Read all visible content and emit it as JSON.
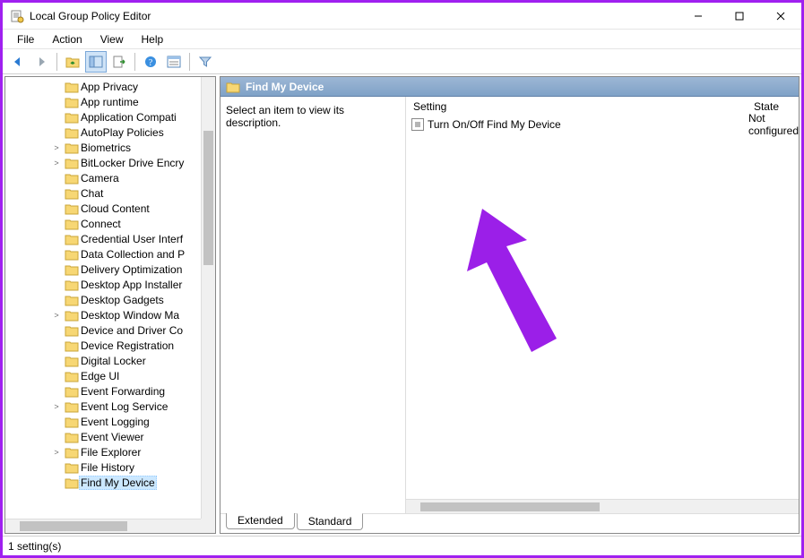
{
  "titlebar": {
    "title": "Local Group Policy Editor"
  },
  "menubar": {
    "items": [
      "File",
      "Action",
      "View",
      "Help"
    ]
  },
  "toolbar": {
    "icons": [
      "back-arrow-icon",
      "forward-arrow-icon",
      "sep",
      "up-folder-icon",
      "show-hide-tree-icon",
      "export-list-icon",
      "sep",
      "help-icon",
      "properties-icon",
      "sep",
      "filter-icon"
    ]
  },
  "tree": {
    "items": [
      {
        "label": "App Privacy",
        "expander": ""
      },
      {
        "label": "App runtime",
        "expander": ""
      },
      {
        "label": "Application Compati",
        "expander": ""
      },
      {
        "label": "AutoPlay Policies",
        "expander": ""
      },
      {
        "label": "Biometrics",
        "expander": ">"
      },
      {
        "label": "BitLocker Drive Encry",
        "expander": ">"
      },
      {
        "label": "Camera",
        "expander": ""
      },
      {
        "label": "Chat",
        "expander": ""
      },
      {
        "label": "Cloud Content",
        "expander": ""
      },
      {
        "label": "Connect",
        "expander": ""
      },
      {
        "label": "Credential User Interf",
        "expander": ""
      },
      {
        "label": "Data Collection and P",
        "expander": ""
      },
      {
        "label": "Delivery Optimization",
        "expander": ""
      },
      {
        "label": "Desktop App Installer",
        "expander": ""
      },
      {
        "label": "Desktop Gadgets",
        "expander": ""
      },
      {
        "label": "Desktop Window Ma",
        "expander": ">"
      },
      {
        "label": "Device and Driver Co",
        "expander": ""
      },
      {
        "label": "Device Registration",
        "expander": ""
      },
      {
        "label": "Digital Locker",
        "expander": ""
      },
      {
        "label": "Edge UI",
        "expander": ""
      },
      {
        "label": "Event Forwarding",
        "expander": ""
      },
      {
        "label": "Event Log Service",
        "expander": ">"
      },
      {
        "label": "Event Logging",
        "expander": ""
      },
      {
        "label": "Event Viewer",
        "expander": ""
      },
      {
        "label": "File Explorer",
        "expander": ">"
      },
      {
        "label": "File History",
        "expander": ""
      },
      {
        "label": "Find My Device",
        "expander": "",
        "selected": true
      }
    ]
  },
  "content": {
    "header": "Find My Device",
    "description": "Select an item to view its description.",
    "columns": {
      "setting": "Setting",
      "state": "State"
    },
    "rows": [
      {
        "setting": "Turn On/Off Find My Device",
        "state": "Not configured"
      }
    ],
    "tabs": {
      "extended": "Extended",
      "standard": "Standard"
    }
  },
  "statusbar": {
    "text": "1 setting(s)"
  }
}
